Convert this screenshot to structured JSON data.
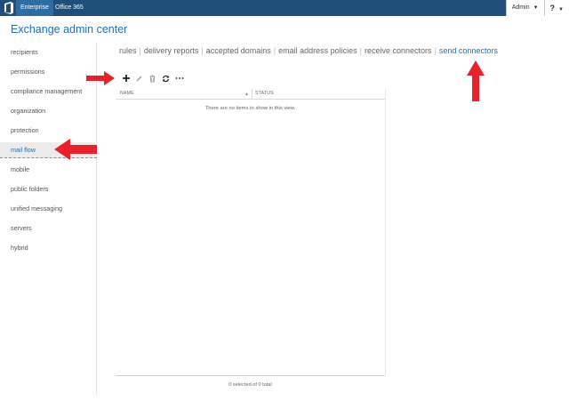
{
  "suite_bar": {
    "tabs": [
      {
        "label": "Enterprise",
        "active": true
      },
      {
        "label": "Office 365",
        "active": false
      }
    ],
    "user_label": "Admin",
    "help_label": "?"
  },
  "header": {
    "title": "Exchange admin center"
  },
  "sidebar": {
    "items": [
      {
        "label": "recipients"
      },
      {
        "label": "permissions"
      },
      {
        "label": "compliance management"
      },
      {
        "label": "organization"
      },
      {
        "label": "protection"
      },
      {
        "label": "mail flow",
        "selected": true
      },
      {
        "label": "mobile"
      },
      {
        "label": "public folders"
      },
      {
        "label": "unified messaging"
      },
      {
        "label": "servers"
      },
      {
        "label": "hybrid"
      }
    ]
  },
  "subnav": {
    "tabs": [
      {
        "label": "rules"
      },
      {
        "label": "delivery reports"
      },
      {
        "label": "accepted domains"
      },
      {
        "label": "email address policies"
      },
      {
        "label": "receive connectors"
      },
      {
        "label": "send connectors",
        "active": true
      }
    ]
  },
  "toolbar": {
    "buttons": [
      "add-icon",
      "edit-icon",
      "delete-icon",
      "refresh-icon",
      "more-icon"
    ]
  },
  "grid": {
    "columns": [
      "NAME",
      "STATUS"
    ],
    "sort_indicator": "▲",
    "empty_message": "There are no items to show in this view."
  },
  "footer": {
    "status": "0 selected of 0 total"
  },
  "colors": {
    "suite_bar": "#1e4e79",
    "accent": "#1e6fb7",
    "callout": "#e8222a"
  }
}
